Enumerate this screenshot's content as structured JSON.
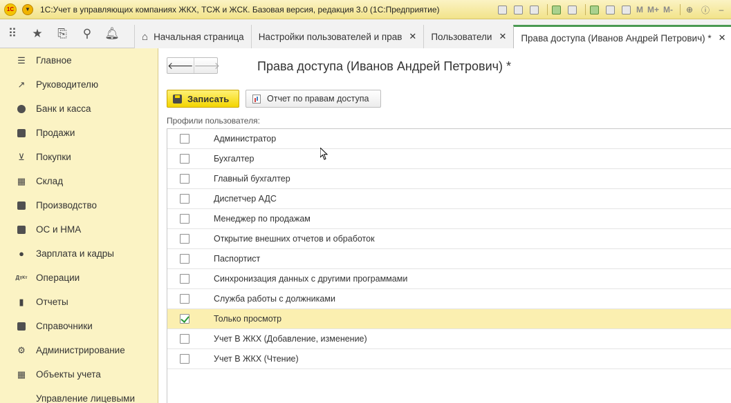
{
  "window": {
    "title": "1С:Учет в управляющих компаниях ЖКХ, ТСЖ и ЖСК. Базовая версия, редакция 3.0  (1С:Предприятие)",
    "logo_text": "1С",
    "toolbar_m": [
      "M",
      "M+",
      "M-"
    ]
  },
  "tabs": [
    {
      "label": "Начальная страница",
      "icon": "home-icon"
    },
    {
      "label": "Настройки пользователей и прав",
      "closable": true
    },
    {
      "label": "Пользователи",
      "closable": true
    },
    {
      "label": "Права доступа (Иванов Андрей Петрович) *",
      "closable": true,
      "active": true
    }
  ],
  "tab_close_glyph": "✕",
  "sidebar": {
    "items": [
      {
        "label": "Главное",
        "icon": "menu-lines-icon"
      },
      {
        "label": "Руководителю",
        "icon": "trend-icon"
      },
      {
        "label": "Банк и касса",
        "icon": "ruble-icon"
      },
      {
        "label": "Продажи",
        "icon": "bag-icon"
      },
      {
        "label": "Покупки",
        "icon": "cart-icon"
      },
      {
        "label": "Склад",
        "icon": "warehouse-icon"
      },
      {
        "label": "Производство",
        "icon": "factory-icon"
      },
      {
        "label": "ОС и НМА",
        "icon": "truck-icon"
      },
      {
        "label": "Зарплата и кадры",
        "icon": "person-icon"
      },
      {
        "label": "Операции",
        "icon": "dt-kt-icon"
      },
      {
        "label": "Отчеты",
        "icon": "bar-chart-icon"
      },
      {
        "label": "Справочники",
        "icon": "book-icon"
      },
      {
        "label": "Администрирование",
        "icon": "gear-icon"
      },
      {
        "label": "Объекты учета",
        "icon": "grid-icon"
      },
      {
        "label": "Управление лицевыми",
        "icon": "accounts-icon"
      }
    ]
  },
  "form": {
    "title": "Права доступа (Иванов Андрей Петрович) *",
    "save_label": "Записать",
    "report_label": "Отчет по правам доступа",
    "profiles_label": "Профили пользователя:",
    "profiles": [
      {
        "label": "Администратор",
        "checked": false
      },
      {
        "label": "Бухгалтер",
        "checked": false
      },
      {
        "label": "Главный бухгалтер",
        "checked": false
      },
      {
        "label": "Диспетчер АДС",
        "checked": false
      },
      {
        "label": "Менеджер по продажам",
        "checked": false
      },
      {
        "label": "Открытие внешних отчетов и обработок",
        "checked": false
      },
      {
        "label": "Паспортист",
        "checked": false
      },
      {
        "label": "Синхронизация данных с другими программами",
        "checked": false
      },
      {
        "label": "Служба работы с должниками",
        "checked": false
      },
      {
        "label": "Только просмотр",
        "checked": true,
        "selected": true
      },
      {
        "label": "Учет В ЖКХ (Добавление, изменение)",
        "checked": false
      },
      {
        "label": "Учет В ЖКХ (Чтение)",
        "checked": false
      }
    ]
  },
  "colors": {
    "sidebar_bg": "#fbf3c4",
    "active_tab_accent": "#4a9a52",
    "save_button": "#f3d500",
    "selected_row": "#fbefb0"
  }
}
